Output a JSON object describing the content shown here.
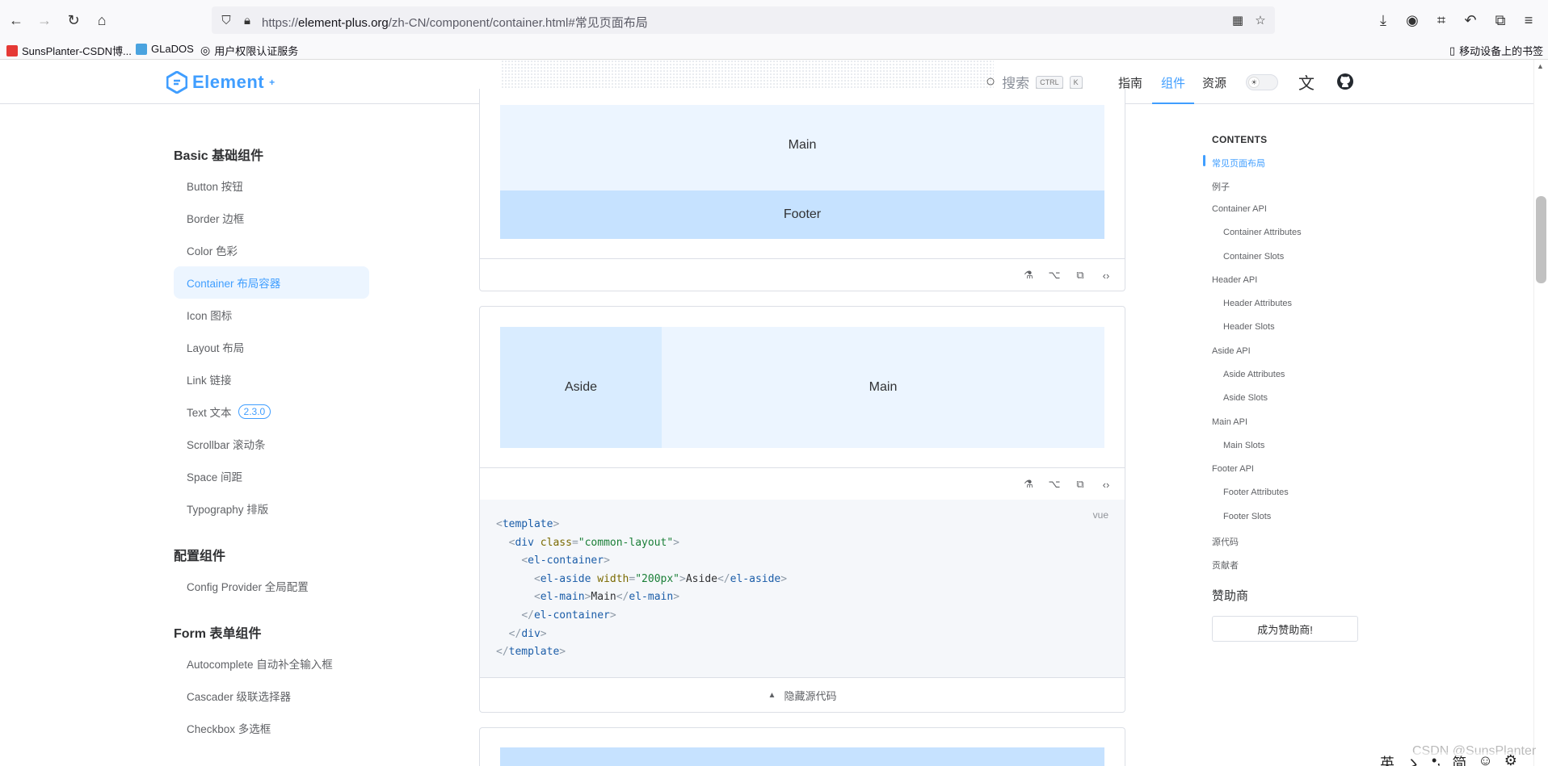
{
  "browser": {
    "url_prefix": "https://",
    "url_host": "element-plus.org",
    "url_path": "/zh-CN/component/container.html#常见页面布局",
    "bookmarks": [
      {
        "label": "SunsPlanter-CSDN博...",
        "color": "#e53935"
      },
      {
        "label": "GLaDOS",
        "color": "#4aa3df"
      },
      {
        "label": "用户权限认证服务",
        "color": "#555555"
      }
    ],
    "mobile_bookmarks": "移动设备上的书签"
  },
  "header": {
    "logo_text": "Element",
    "logo_sup": "+",
    "search_placeholder": "搜索",
    "kbd_ctrl": "CTRL",
    "kbd_k": "K",
    "nav": [
      {
        "label": "指南",
        "active": false
      },
      {
        "label": "组件",
        "active": true
      },
      {
        "label": "资源",
        "active": false
      }
    ]
  },
  "sidebar": {
    "groups": [
      {
        "title": "Basic 基础组件",
        "items": [
          {
            "label": "Button 按钮"
          },
          {
            "label": "Border 边框"
          },
          {
            "label": "Color 色彩"
          },
          {
            "label": "Container 布局容器",
            "active": true
          },
          {
            "label": "Icon 图标"
          },
          {
            "label": "Layout 布局"
          },
          {
            "label": "Link 链接"
          },
          {
            "label": "Text 文本",
            "tag": "2.3.0"
          },
          {
            "label": "Scrollbar 滚动条"
          },
          {
            "label": "Space 间距"
          },
          {
            "label": "Typography 排版"
          }
        ]
      },
      {
        "title": "配置组件",
        "items": [
          {
            "label": "Config Provider 全局配置"
          }
        ]
      },
      {
        "title": "Form 表单组件",
        "items": [
          {
            "label": "Autocomplete 自动补全输入框"
          },
          {
            "label": "Cascader 级联选择器"
          },
          {
            "label": "Checkbox 多选框"
          }
        ]
      }
    ]
  },
  "demo1": {
    "main": "Main",
    "footer": "Footer"
  },
  "demo2": {
    "aside": "Aside",
    "main": "Main",
    "lang": "vue",
    "code": {
      "template": "template",
      "div": "div",
      "class_attr": "class",
      "class_val": "\"common-layout\"",
      "container": "el-container",
      "aside_tag": "el-aside",
      "width_attr": "width",
      "width_val": "\"200px\"",
      "aside_text": "Aside",
      "main_tag": "el-main",
      "main_text": "Main"
    },
    "hide_code": "隐藏源代码"
  },
  "toc": {
    "title": "CONTENTS",
    "items": [
      {
        "label": "常见页面布局",
        "level": 1,
        "active": true
      },
      {
        "label": "例子",
        "level": 1
      },
      {
        "label": "Container API",
        "level": 1
      },
      {
        "label": "Container Attributes",
        "level": 2
      },
      {
        "label": "Container Slots",
        "level": 2
      },
      {
        "label": "Header API",
        "level": 1
      },
      {
        "label": "Header Attributes",
        "level": 2
      },
      {
        "label": "Header Slots",
        "level": 2
      },
      {
        "label": "Aside API",
        "level": 1
      },
      {
        "label": "Aside Attributes",
        "level": 2
      },
      {
        "label": "Aside Slots",
        "level": 2
      },
      {
        "label": "Main API",
        "level": 1
      },
      {
        "label": "Main Slots",
        "level": 2
      },
      {
        "label": "Footer API",
        "level": 1
      },
      {
        "label": "Footer Attributes",
        "level": 2
      },
      {
        "label": "Footer Slots",
        "level": 2
      },
      {
        "label": "源代码",
        "level": 1
      },
      {
        "label": "贡献者",
        "level": 1
      }
    ],
    "sponsor_title": "赞助商",
    "sponsor_button": "成为赞助商!"
  },
  "overlay": {
    "watermark": "CSDN @SunsPlanter",
    "ime": [
      "英",
      "ゝ",
      "•,",
      "简",
      "☺",
      "⚙"
    ]
  },
  "colors": {
    "accent": "#409eff",
    "block_light": "#ecf5ff",
    "block_mid": "#d9ecff",
    "block_dark": "#c6e2ff"
  }
}
